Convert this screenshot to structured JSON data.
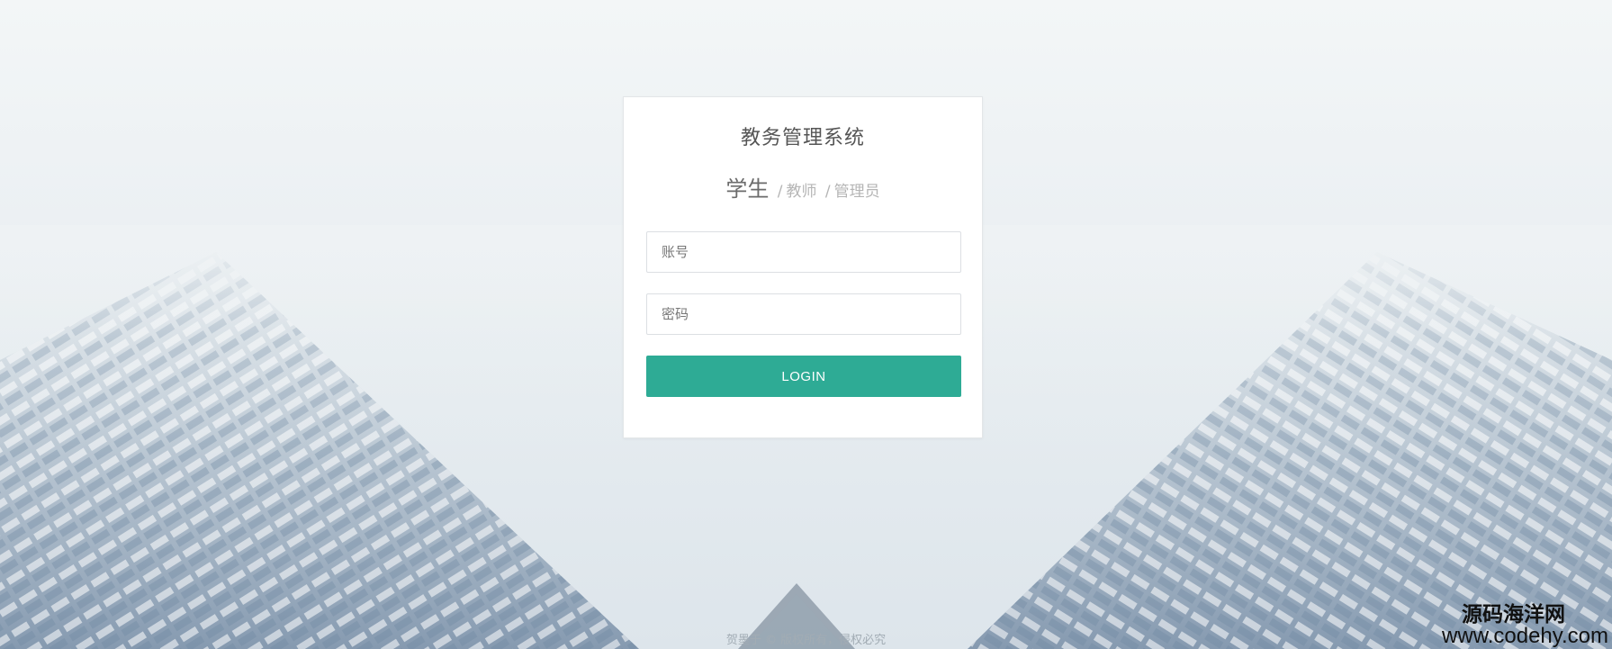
{
  "login": {
    "title": "教务管理系统",
    "roles": {
      "active": "学生",
      "separator": "/",
      "teacher": "教师",
      "admin": "管理员"
    },
    "account_placeholder": "账号",
    "password_placeholder": "密码",
    "login_label": "LOGIN"
  },
  "footer": {
    "copyright": "贺墨于 © 版权所有，侵权必究"
  },
  "watermark": {
    "name": "源码海洋网",
    "url": "www.codehy.com"
  },
  "colors": {
    "accent": "#2eab95",
    "background": "#edf1f3"
  }
}
